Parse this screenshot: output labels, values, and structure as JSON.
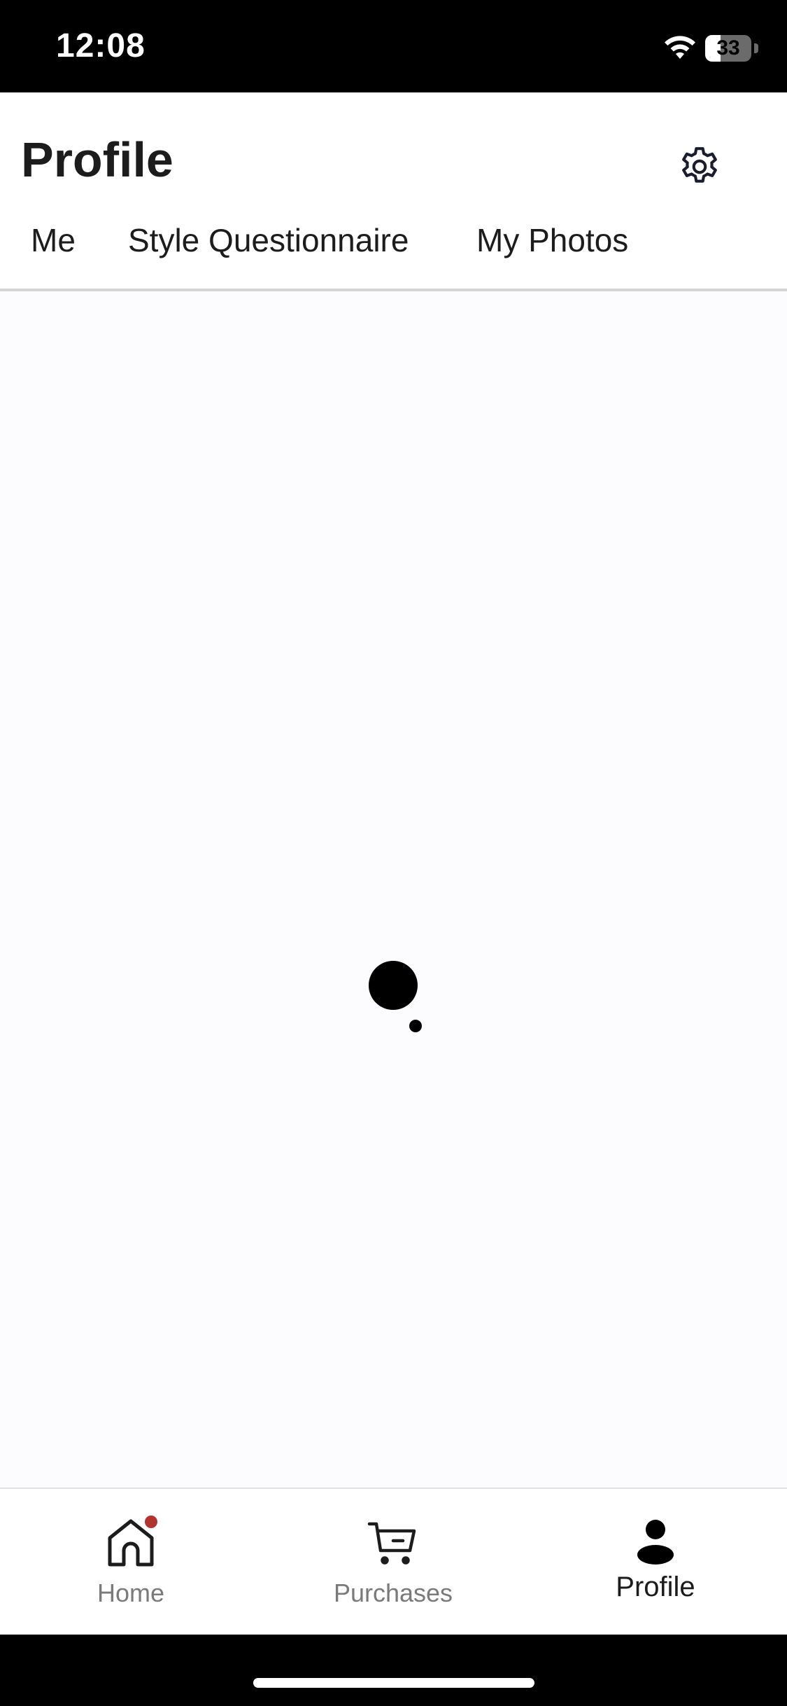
{
  "status_bar": {
    "time": "12:08",
    "battery_level": "33",
    "wifi_icon": "wifi-icon",
    "battery_icon": "battery-icon"
  },
  "header": {
    "title": "Profile",
    "settings_icon": "gear-icon"
  },
  "tabs": [
    {
      "label": "Me",
      "selected": false
    },
    {
      "label": "Style Questionnaire",
      "selected": true
    },
    {
      "label": "My Photos",
      "selected": false
    }
  ],
  "main": {
    "state": "loading",
    "loader_icon": "loading-spinner-icon"
  },
  "bottom_nav": {
    "items": [
      {
        "label": "Home",
        "icon": "home-icon",
        "has_badge": true,
        "selected": false
      },
      {
        "label": "Purchases",
        "icon": "cart-icon",
        "has_badge": false,
        "selected": false
      },
      {
        "label": "Profile",
        "icon": "person-icon",
        "has_badge": false,
        "selected": true
      }
    ]
  },
  "colors": {
    "accent": "#222222",
    "badge": "#b3342d",
    "content_background": "#fcfbfd",
    "inactive_nav": "#7a7a7a"
  }
}
